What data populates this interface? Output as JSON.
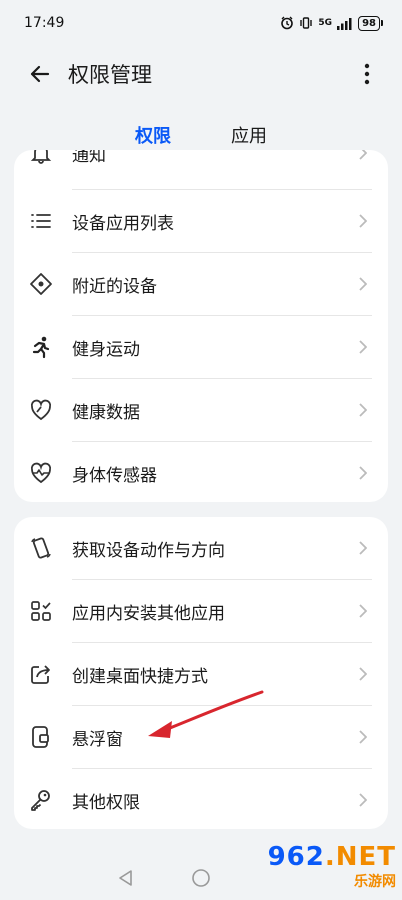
{
  "status": {
    "time": "17:49",
    "network": "5G",
    "battery": "98"
  },
  "header": {
    "title": "权限管理"
  },
  "tabs": [
    {
      "label": "权限",
      "active": true
    },
    {
      "label": "应用",
      "active": false
    }
  ],
  "group1": {
    "partial_label": "通知",
    "items": [
      {
        "label": "设备应用列表",
        "icon": "list-icon"
      },
      {
        "label": "附近的设备",
        "icon": "nearby-devices-icon"
      },
      {
        "label": "健身运动",
        "icon": "running-person-icon"
      },
      {
        "label": "健康数据",
        "icon": "health-data-icon"
      },
      {
        "label": "身体传感器",
        "icon": "heartbeat-icon"
      }
    ]
  },
  "group2": {
    "items": [
      {
        "label": "获取设备动作与方向",
        "icon": "device-motion-icon"
      },
      {
        "label": "应用内安装其他应用",
        "icon": "app-grid-icon"
      },
      {
        "label": "创建桌面快捷方式",
        "icon": "share-shortcut-icon"
      },
      {
        "label": "悬浮窗",
        "icon": "floating-window-icon"
      },
      {
        "label": "其他权限",
        "icon": "key-icon"
      }
    ]
  },
  "annotation": {
    "color": "#d8262e"
  },
  "watermark": {
    "logo_main": "962",
    "logo_suffix": ".NET",
    "sub": "乐游网"
  },
  "colors": {
    "accent": "#0a59f7",
    "background": "#f1f3f5",
    "card": "#ffffff"
  }
}
